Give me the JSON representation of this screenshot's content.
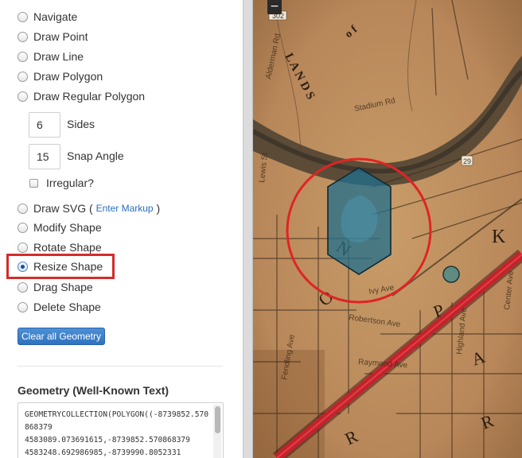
{
  "modes": [
    {
      "label": "Navigate",
      "checked": false
    },
    {
      "label": "Draw Point",
      "checked": false
    },
    {
      "label": "Draw Line",
      "checked": false
    },
    {
      "label": "Draw Polygon",
      "checked": false
    },
    {
      "label": "Draw Regular Polygon",
      "checked": false
    }
  ],
  "regular_polygon": {
    "sides_value": "6",
    "sides_label": "Sides",
    "snap_value": "15",
    "snap_label": "Snap Angle",
    "irregular_label": "Irregular?"
  },
  "svg_mode": {
    "label": "Draw SVG (",
    "link": "Enter Markup",
    "close": ")"
  },
  "edit_modes": [
    {
      "label": "Modify Shape",
      "checked": false
    },
    {
      "label": "Rotate Shape",
      "checked": false
    },
    {
      "label": "Resize Shape",
      "checked": true
    },
    {
      "label": "Drag Shape",
      "checked": false
    },
    {
      "label": "Delete Shape",
      "checked": false
    }
  ],
  "clear_button": "Clear all Geometry",
  "geometry_heading": "Geometry (Well-Known Text)",
  "wkt": "GEOMETRYCOLLECTION(POLYGON((-8739852.570868379\n4583089.073691615,-8739852.570868379\n4583248.692986985,-8739990.8052331",
  "map": {
    "zoom_out": "−",
    "route_shield": "302",
    "route_29": "29",
    "streets": [
      "Alderman Rd",
      "Stadium Rd",
      "Lewis St",
      "Ivy Ave",
      "Robertson Ave",
      "Raymond Ave",
      "Fendling Ave",
      "Highland Ave",
      "Center Ave"
    ],
    "old_map_letters": [
      "N",
      "O",
      "R",
      "K",
      "P",
      "A",
      "R"
    ],
    "old_map_words": [
      "L A N D S",
      "o f"
    ]
  },
  "colors": {
    "accent": "#2f73bf",
    "highlight": "#d42b2b",
    "polygon_fill": "#1f6e8c",
    "circle": "#e02424",
    "road": "#c8202a"
  }
}
